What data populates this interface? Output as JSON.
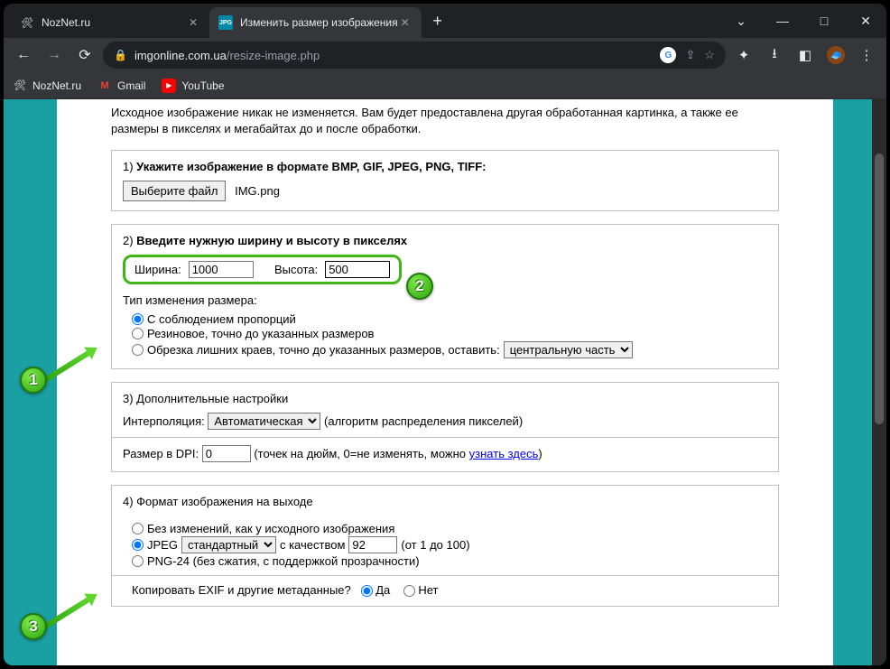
{
  "tabs": [
    {
      "title": "NozNet.ru",
      "favicon": "✕"
    },
    {
      "title": "Изменить размер изображения",
      "favicon": "JPG"
    }
  ],
  "addr": {
    "host": "imgonline.com.ua",
    "path": "/resize-image.php"
  },
  "bookmarks": [
    {
      "label": "NozNet.ru"
    },
    {
      "label": "Gmail"
    },
    {
      "label": "YouTube"
    }
  ],
  "intro": "Исходное изображение никак не изменяется. Вам будет предоставлена другая обработанная картинка, а также ее размеры в пикселях и мегабайтах до и после обработки.",
  "step1": {
    "title_num": "1) ",
    "title": "Укажите изображение в формате BMP, GIF, JPEG, PNG, TIFF:",
    "button": "Выберите файл",
    "filename": "IMG.png"
  },
  "step2": {
    "title_num": "2) ",
    "title": "Введите нужную ширину и высоту в пикселях",
    "width_label": "Ширина:",
    "width_value": "1000",
    "height_label": "Высота:",
    "height_value": "500",
    "type_label": "Тип изменения размера:",
    "r1": "С соблюдением пропорций",
    "r2": "Резиновое, точно до указанных размеров",
    "r3": "Обрезка лишних краев, точно до указанных размеров, оставить:",
    "crop_select": "центральную часть"
  },
  "step3": {
    "title_num": "3) ",
    "title": "Дополнительные настройки",
    "interp_label": "Интерполяция:",
    "interp_value": "Автоматическая",
    "interp_hint": "(алгоритм распределения пикселей)",
    "dpi_label": "Размер в DPI:",
    "dpi_value": "0",
    "dpi_hint1": "(точек на дюйм, 0=не изменять, можно ",
    "dpi_link": "узнать здесь",
    "dpi_hint2": ")"
  },
  "step4": {
    "title_num": "4) ",
    "title": "Формат изображения на выходе",
    "r1": "Без изменений, как у исходного изображения",
    "r2a": "JPEG",
    "jpeg_select": "стандартный",
    "r2b": "с качеством",
    "quality": "92",
    "r2c": "(от 1 до 100)",
    "r3": "PNG-24 (без сжатия, с поддержкой прозрачности)",
    "exif_label": "Копировать EXIF и другие метаданные?",
    "yes": "Да",
    "no": "Нет"
  }
}
